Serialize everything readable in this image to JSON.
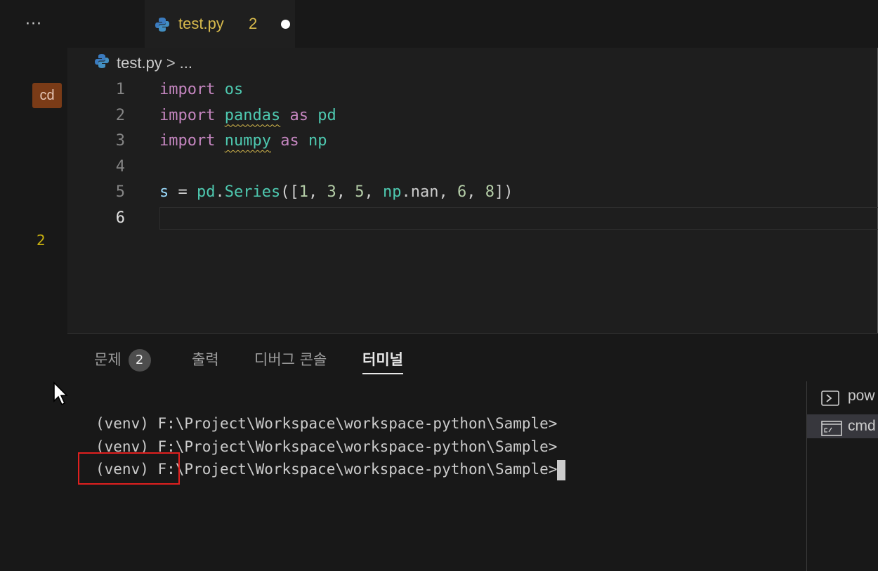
{
  "sidebar": {
    "more_label": "···",
    "badge_label": "cd",
    "problem_count": "2"
  },
  "editor_tab": {
    "filename": "test.py",
    "problem_count": "2"
  },
  "breadcrumb": {
    "file": "test.py",
    "separator": ">",
    "more": "..."
  },
  "code_lines": [
    {
      "num": "1",
      "text": "import os"
    },
    {
      "num": "2",
      "text": "import pandas as pd"
    },
    {
      "num": "3",
      "text": "import numpy as np"
    },
    {
      "num": "4",
      "text": ""
    },
    {
      "num": "5",
      "text": "s = pd.Series([1, 3, 5, np.nan, 6, 8])"
    },
    {
      "num": "6",
      "text": ""
    }
  ],
  "panel": {
    "tabs": [
      {
        "label": "문제",
        "badge": "2"
      },
      {
        "label": "출력"
      },
      {
        "label": "디버그 콘솔"
      },
      {
        "label": "터미널"
      }
    ],
    "active_tab": "터미널"
  },
  "terminal": {
    "lines": [
      "(venv) F:\\Project\\Workspace\\workspace-python\\Sample>",
      "(venv) F:\\Project\\Workspace\\workspace-python\\Sample>",
      "(venv) F:\\Project\\Workspace\\workspace-python\\Sample>"
    ]
  },
  "terminal_list": [
    {
      "label": "pow",
      "icon": "powershell-icon"
    },
    {
      "label": "cmd",
      "icon": "cmd-icon"
    }
  ],
  "colors": {
    "keyword": "#c586c0",
    "module": "#4ec9b0",
    "number": "#b5cea8",
    "warning": "#d7ba4c",
    "highlight_box": "#e0201f"
  }
}
